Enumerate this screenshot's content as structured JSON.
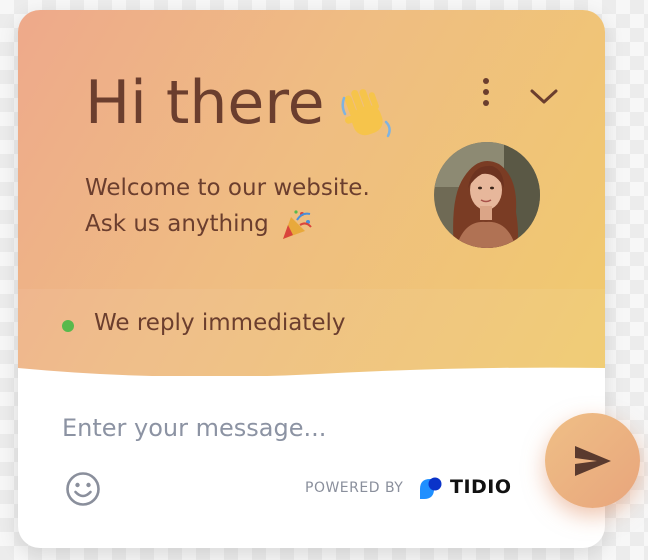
{
  "header": {
    "greeting": "Hi there",
    "welcome_line_1": "Welcome to our website.",
    "welcome_line_2": "Ask us anything",
    "status_text": "We reply immediately",
    "status_color": "#58b94c"
  },
  "composer": {
    "placeholder": "Enter your message...",
    "value": ""
  },
  "footer": {
    "powered_by": "POWERED BY",
    "brand": "TIDIO"
  },
  "icons": {
    "wave": "waving-hand-icon",
    "party": "party-popper-icon",
    "menu": "more-vertical-icon",
    "collapse": "chevron-down-icon",
    "emoji": "smiley-icon",
    "send": "send-icon",
    "brand": "tidio-logo-icon"
  },
  "colors": {
    "gradient_start": "#eea98b",
    "gradient_end": "#f0ca6e",
    "text_brown": "#6b3e2e",
    "send_button": "#efbf86"
  }
}
